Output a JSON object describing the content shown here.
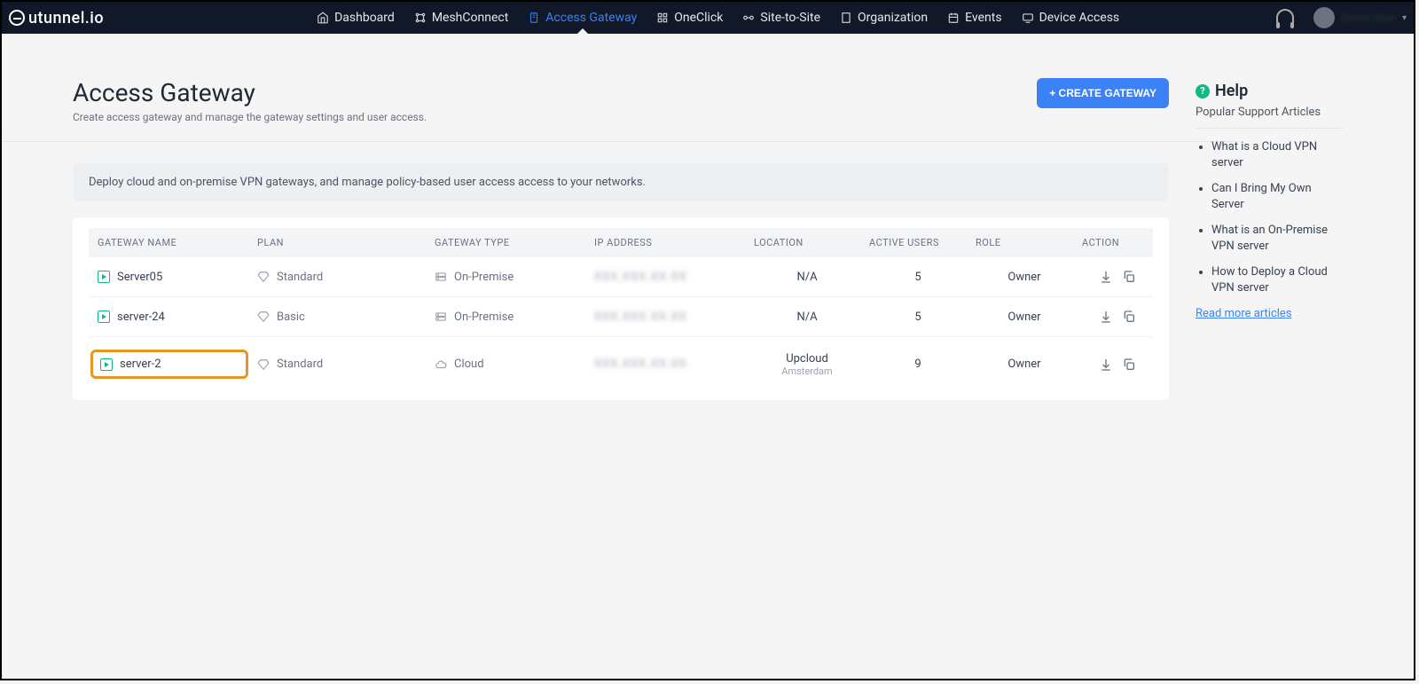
{
  "brand": "utunnel.io",
  "nav": [
    {
      "label": "Dashboard",
      "active": false
    },
    {
      "label": "MeshConnect",
      "active": false
    },
    {
      "label": "Access Gateway",
      "active": true
    },
    {
      "label": "OneClick",
      "active": false
    },
    {
      "label": "Site-to-Site",
      "active": false
    },
    {
      "label": "Organization",
      "active": false
    },
    {
      "label": "Events",
      "active": false
    },
    {
      "label": "Device Access",
      "active": false
    }
  ],
  "user": {
    "name": "Demo User"
  },
  "page": {
    "title": "Access Gateway",
    "subtitle": "Create access gateway and manage the gateway settings and user access.",
    "create_btn": "+ CREATE GATEWAY",
    "banner": "Deploy cloud and on-premise VPN gateways, and manage policy-based user access access to your networks."
  },
  "table": {
    "headers": [
      "GATEWAY NAME",
      "PLAN",
      "GATEWAY TYPE",
      "IP ADDRESS",
      "LOCATION",
      "ACTIVE USERS",
      "ROLE",
      "ACTION"
    ],
    "rows": [
      {
        "name": "Server05",
        "plan": "Standard",
        "type": "On-Premise",
        "ip": "XXX.XXX.XX.XX",
        "location": "N/A",
        "loc_sub": "",
        "users": "5",
        "role": "Owner",
        "highlight": false
      },
      {
        "name": "server-24",
        "plan": "Basic",
        "type": "On-Premise",
        "ip": "XXX.XXX.XX.XX",
        "location": "N/A",
        "loc_sub": "",
        "users": "5",
        "role": "Owner",
        "highlight": false
      },
      {
        "name": "server-2",
        "plan": "Standard",
        "type": "Cloud",
        "ip": "XXX.XXX.XX.XX",
        "location": "Upcloud",
        "loc_sub": "Amsterdam",
        "users": "9",
        "role": "Owner",
        "highlight": true
      }
    ]
  },
  "help": {
    "title": "Help",
    "subtitle": "Popular Support Articles",
    "articles": [
      "What is a Cloud VPN server",
      "Can I Bring My Own Server",
      "What is an On-Premise VPN server",
      "How to Deploy a Cloud VPN server"
    ],
    "read_more": "Read more articles"
  }
}
